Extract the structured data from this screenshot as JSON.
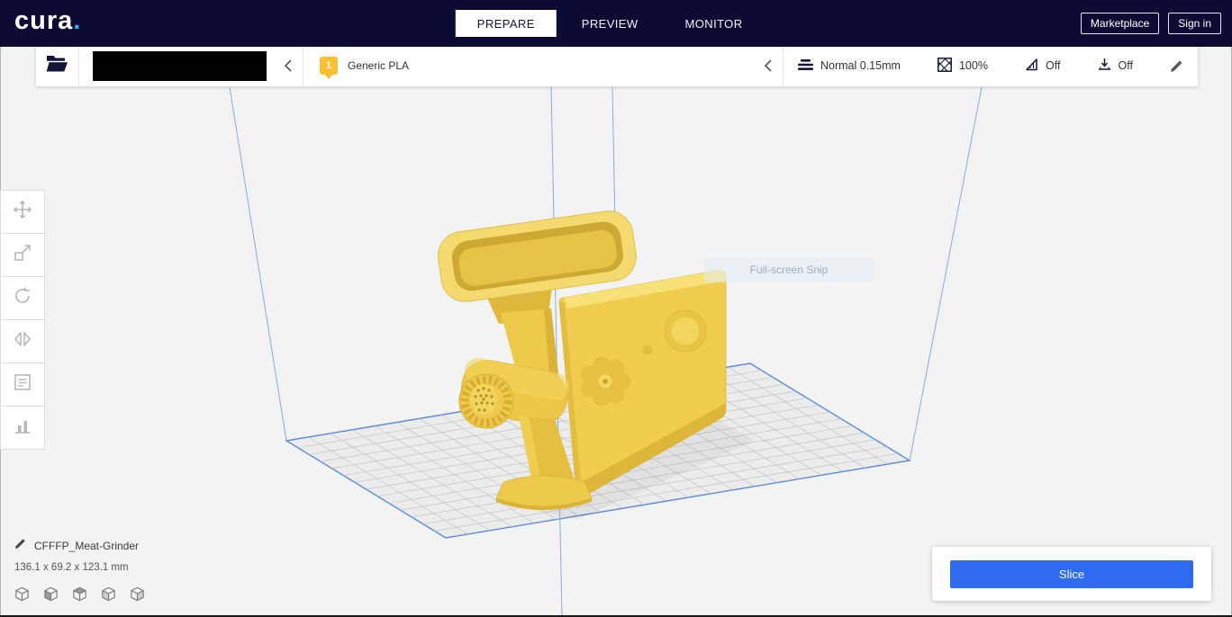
{
  "header": {
    "logo_text": "cura",
    "logo_dot": ".",
    "tabs": [
      {
        "label": "PREPARE",
        "active": true
      },
      {
        "label": "PREVIEW",
        "active": false
      },
      {
        "label": "MONITOR",
        "active": false
      }
    ],
    "marketplace_label": "Marketplace",
    "signin_label": "Sign in"
  },
  "config_bar": {
    "extruder_number": "1",
    "material_name": "Generic PLA",
    "profile_label": "Normal 0.15mm",
    "infill_value": "100%",
    "support_value": "Off",
    "adhesion_value": "Off"
  },
  "sidebar": {
    "tools": [
      "move",
      "scale",
      "rotate",
      "mirror",
      "per-model-settings",
      "support-blocker"
    ]
  },
  "viewport": {
    "watermark_text": "Full-screen Snip"
  },
  "model_info": {
    "name": "CFFFP_Meat-Grinder",
    "dimensions": "136.1 x 69.2 x 123.1 mm"
  },
  "view_presets": [
    "3d-view",
    "front-view",
    "top-view",
    "left-view",
    "right-view"
  ],
  "slice_panel": {
    "slice_label": "Slice"
  },
  "icons": {
    "open_file": "folder-open",
    "collapse_panels": "chevron-left",
    "profile": "layers",
    "infill": "crosshatch-square",
    "support": "support-overhang",
    "adhesion": "adhesion-arrow",
    "edit_settings": "pencil",
    "rename_model": "pencil"
  },
  "colors": {
    "header_bg": "#0b0b33",
    "accent_blue": "#2f6bf0",
    "logo_dot_blue": "#2db1e8",
    "material_yellow": "#fcbe32",
    "model_yellow": "#f1cd4f",
    "build_plate_line": "#5b8bd4"
  }
}
